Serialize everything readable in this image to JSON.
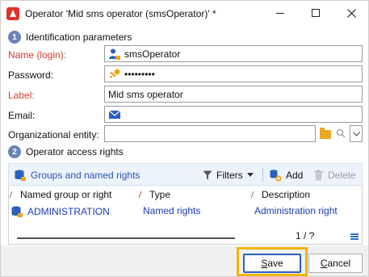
{
  "window": {
    "title": "Operator 'Mid sms operator (smsOperator)' *",
    "app_icon": "adobe-campaign-icon",
    "accent_color": "#e0312b"
  },
  "identification": {
    "step": "1",
    "title": "Identification parameters",
    "fields": {
      "name_label": "Name (login):",
      "name_value": "smsOperator",
      "password_label": "Password:",
      "password_value": "•••••••••",
      "label_label": "Label:",
      "label_value": "Mid sms operator",
      "email_label": "Email:",
      "email_value": "",
      "org_label": "Organizational entity:",
      "org_value": ""
    },
    "required_color": "#d93a30"
  },
  "access_rights": {
    "step": "2",
    "title": "Operator access rights",
    "toolbar": {
      "groups_label": "Groups and named rights",
      "filters_label": "Filters",
      "add_label": "Add",
      "delete_label": "Delete"
    },
    "columns": [
      "Named group or right",
      "Type",
      "Description"
    ],
    "rows": [
      {
        "name": "ADMINISTRATION",
        "type": "Named rights",
        "description": "Administration right"
      }
    ],
    "pager": "1 / ?"
  },
  "buttons": {
    "save": "Save",
    "cancel": "Cancel"
  },
  "highlight_color": "#f2b400"
}
